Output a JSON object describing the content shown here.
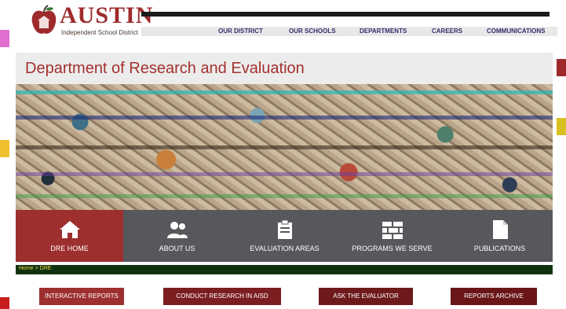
{
  "logo": {
    "word": "AUSTIN",
    "subtitle": "Independent School District",
    "alt": "apple-logo"
  },
  "topnav": {
    "items": [
      "OUR DISTRICT",
      "OUR SCHOOLS",
      "DEPARTMENTS",
      "CAREERS",
      "COMMUNICATIONS"
    ]
  },
  "page": {
    "title": "Department of Research and Evaluation"
  },
  "tiles": [
    {
      "label": "DRE HOME",
      "icon": "home-icon",
      "active": true
    },
    {
      "label": "ABOUT US",
      "icon": "people-icon",
      "active": false
    },
    {
      "label": "EVALUATION AREAS",
      "icon": "clipboard-icon",
      "active": false
    },
    {
      "label": "PROGRAMS WE SERVE",
      "icon": "bricks-icon",
      "active": false
    },
    {
      "label": "PUBLICATIONS",
      "icon": "document-icon",
      "active": false
    }
  ],
  "breadcrumb": {
    "text": "Home > DRE"
  },
  "buttons": [
    {
      "label": "INTERACTIVE REPORTS"
    },
    {
      "label": "CONDUCT RESEARCH IN AISD"
    },
    {
      "label": "ASK THE EVALUATOR"
    },
    {
      "label": "REPORTS ARCHIVE"
    }
  ],
  "colors": {
    "brand_red": "#9e2f2f",
    "tile_gray": "#57585b",
    "nav_text": "#3c2a6e"
  }
}
